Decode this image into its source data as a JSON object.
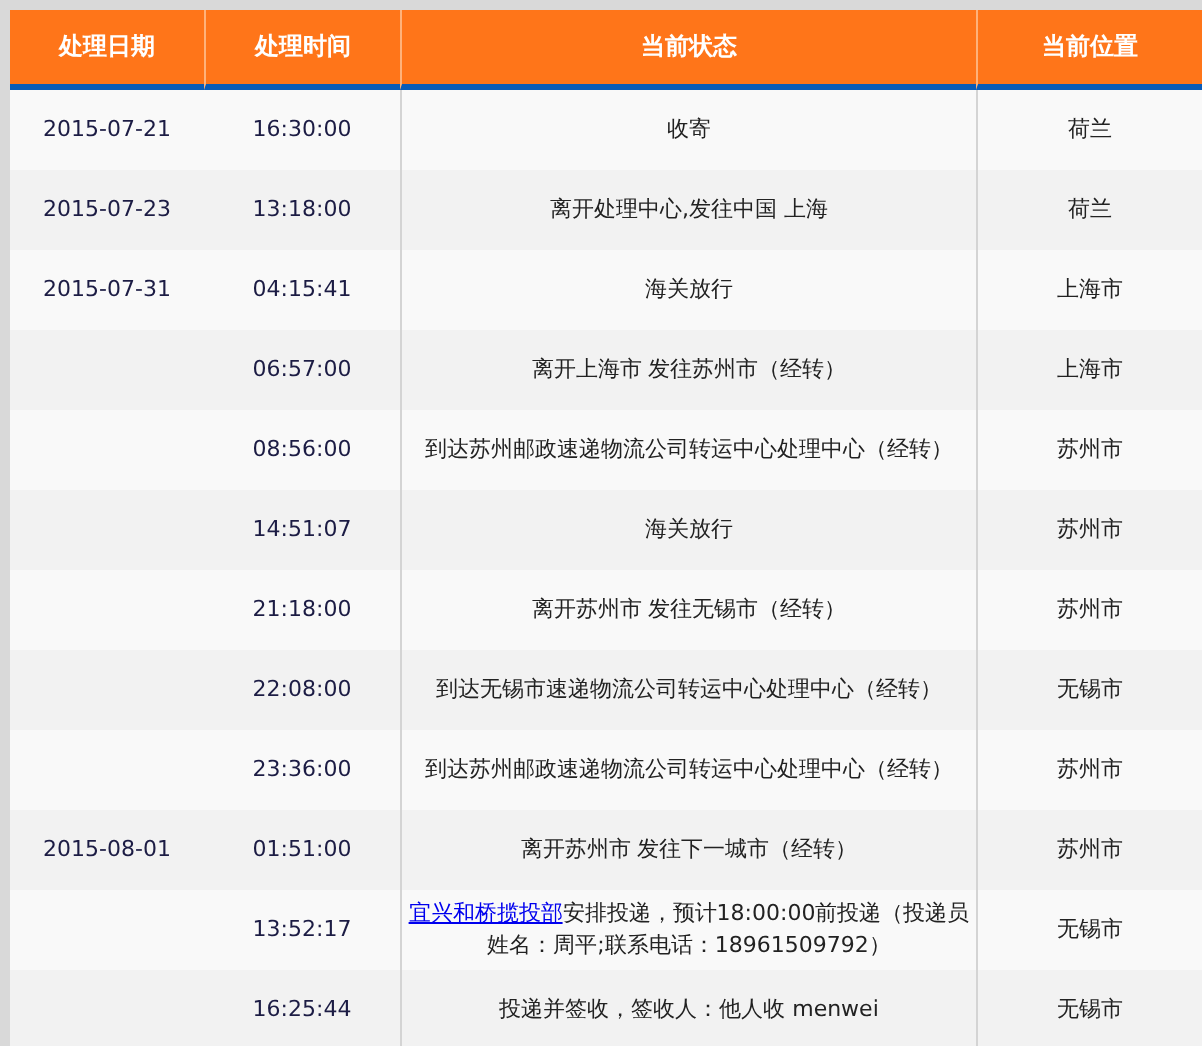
{
  "table": {
    "columns": [
      "处理日期",
      "处理时间",
      "当前状态",
      "当前位置"
    ],
    "rows": [
      {
        "date": "2015-07-21",
        "time": "16:30:00",
        "status": "收寄",
        "location": "荷兰"
      },
      {
        "date": "2015-07-23",
        "time": "13:18:00",
        "status": "离开处理中心,发往中国 上海",
        "location": "荷兰"
      },
      {
        "date": "2015-07-31",
        "time": "04:15:41",
        "status": "海关放行",
        "location": "上海市"
      },
      {
        "time": "06:57:00",
        "status": "离开上海市 发往苏州市（经转）",
        "location": "上海市"
      },
      {
        "time": "08:56:00",
        "status": "到达苏州邮政速递物流公司转运中心处理中心（经转）",
        "location": "苏州市"
      },
      {
        "time": "14:51:07",
        "status": "海关放行",
        "location": "苏州市"
      },
      {
        "time": "21:18:00",
        "status": "离开苏州市 发往无锡市（经转）",
        "location": "苏州市"
      },
      {
        "time": "22:08:00",
        "status": "到达无锡市速递物流公司转运中心处理中心（经转）",
        "location": "无锡市"
      },
      {
        "time": "23:36:00",
        "status": "到达苏州邮政速递物流公司转运中心处理中心（经转）",
        "location": "苏州市"
      },
      {
        "date": "2015-08-01",
        "time": "01:51:00",
        "status": "离开苏州市 发往下一城市（经转）",
        "location": "苏州市"
      },
      {
        "time": "13:52:17",
        "status_link": "宜兴和桥揽投部",
        "status": "安排投递，预计18:00:00前投递（投递员姓名：周平;联系电话：18961509792）",
        "location": "无锡市"
      },
      {
        "time": "16:25:44",
        "status": "投递并签收，签收人：他人收 menwei",
        "location": "无锡市"
      }
    ]
  }
}
